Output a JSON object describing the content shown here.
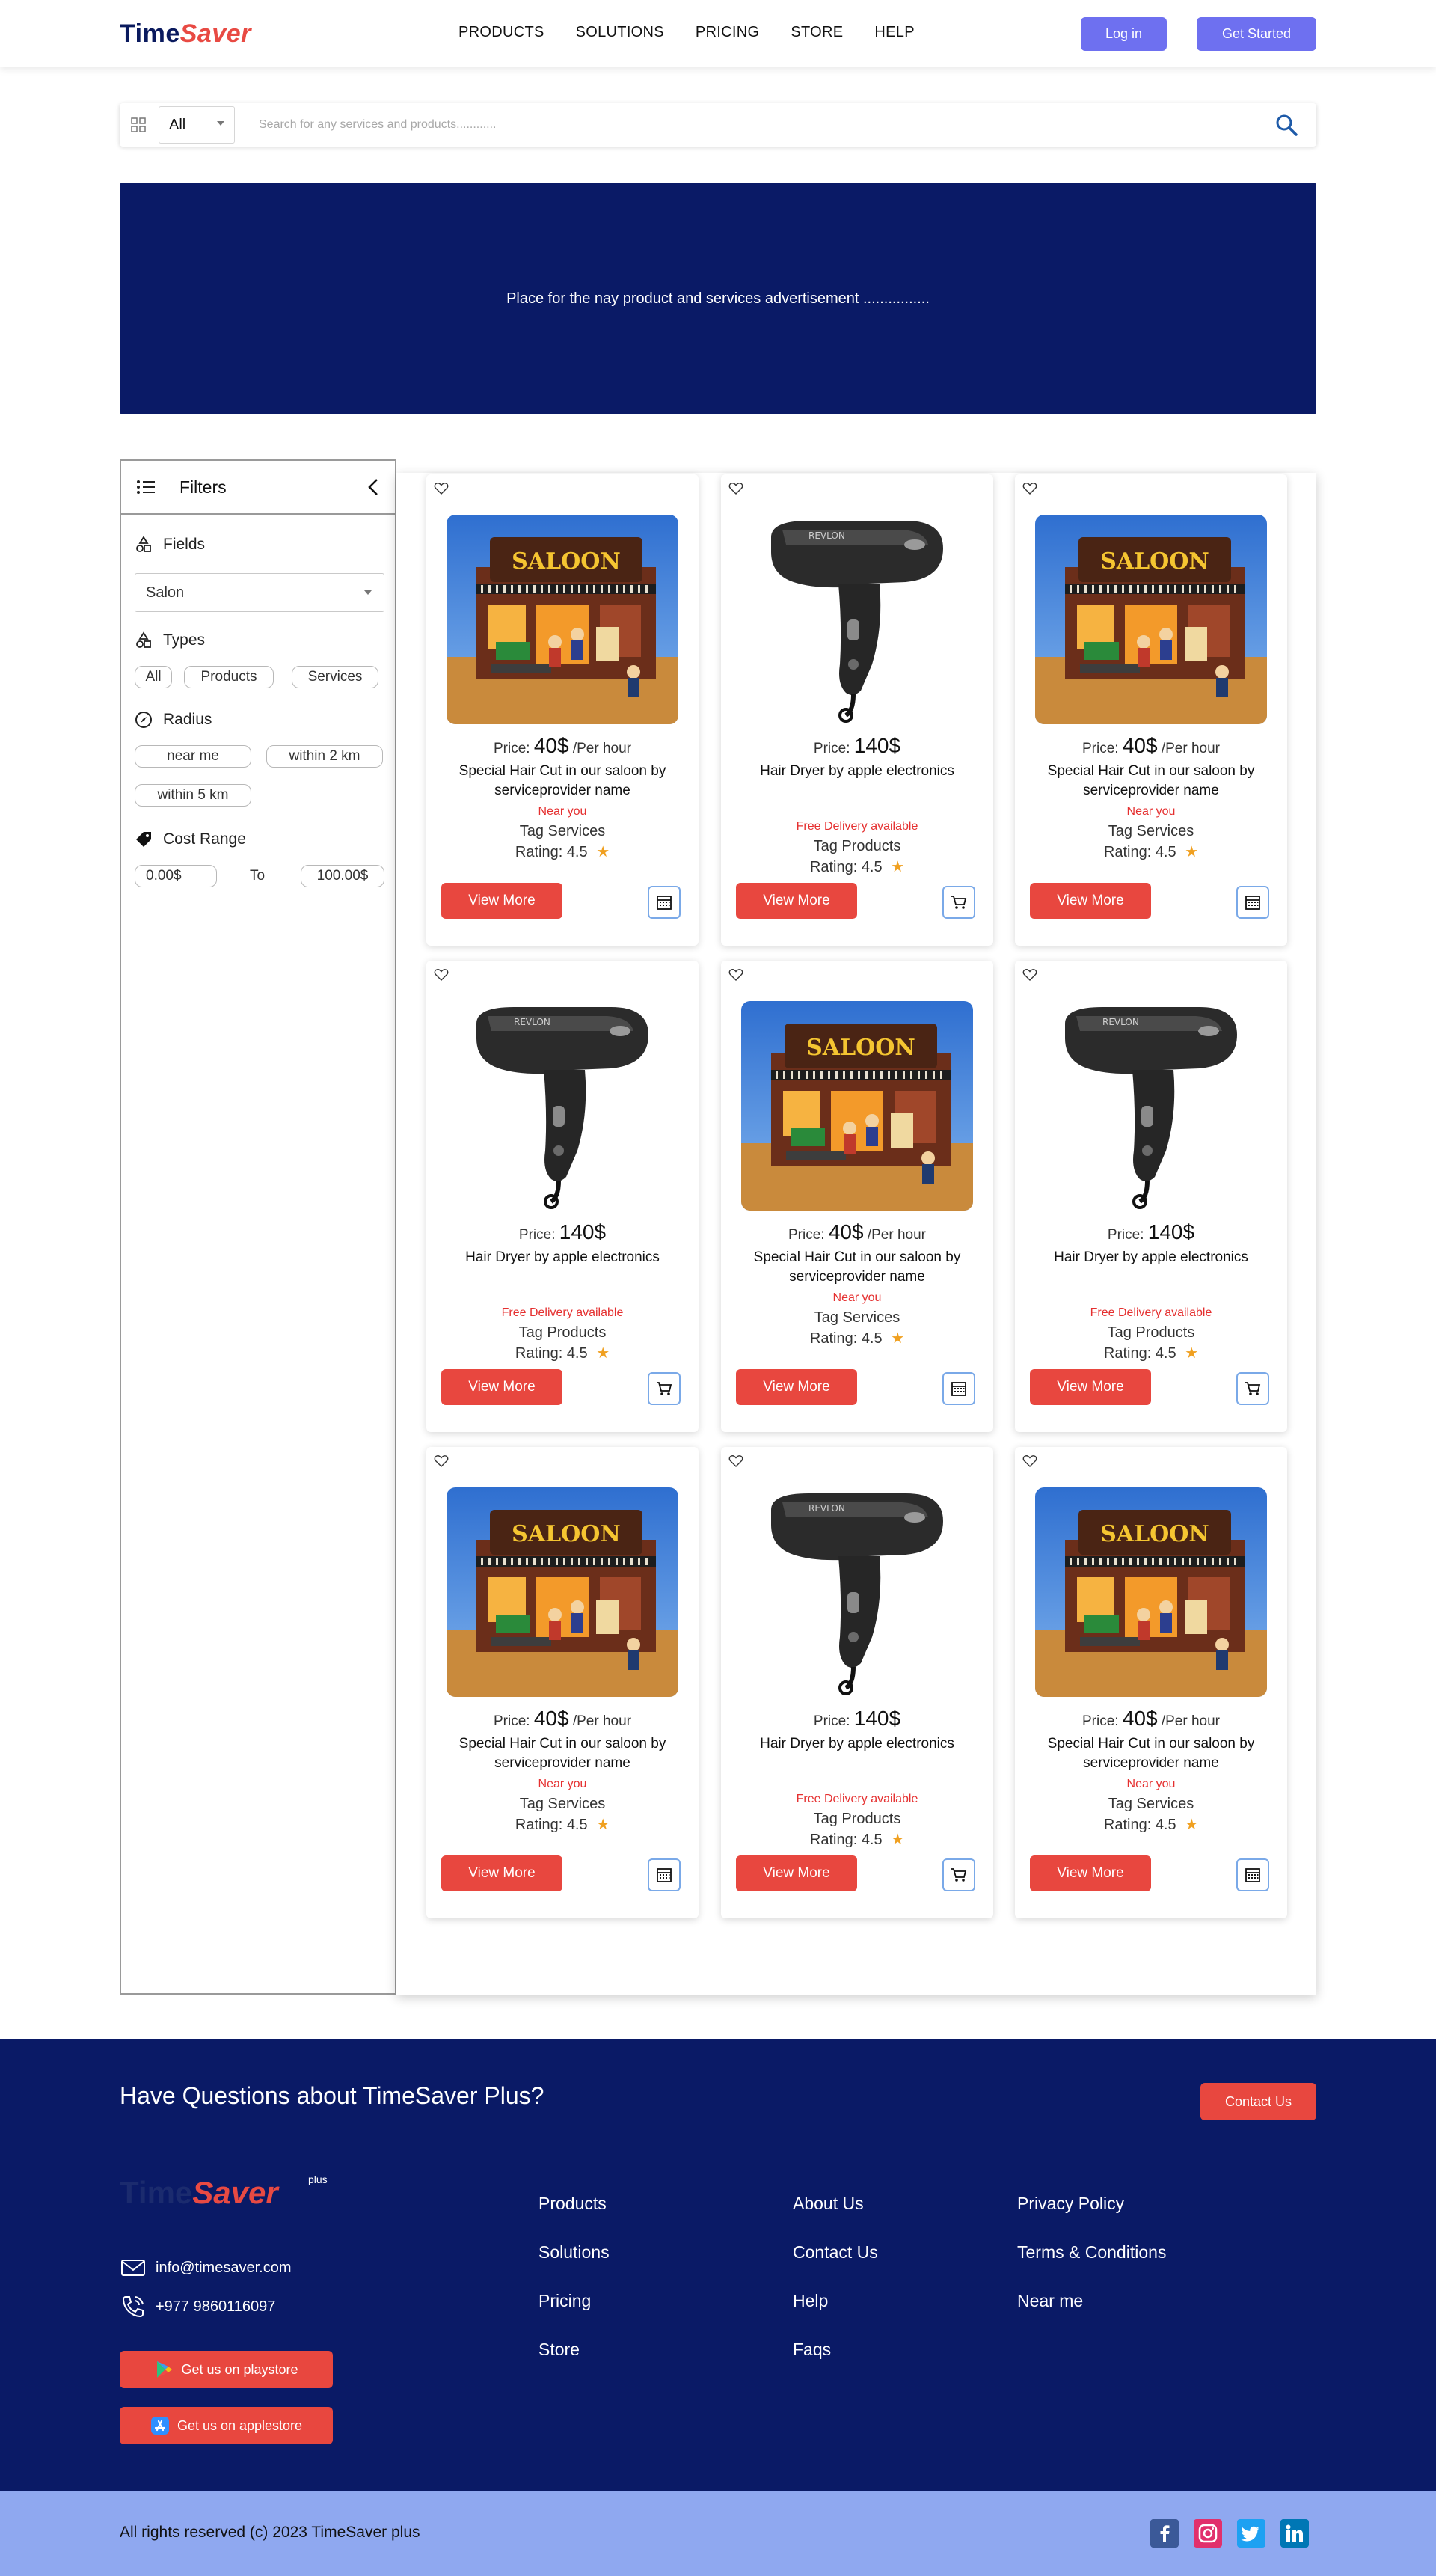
{
  "header": {
    "logo_part1": "Time",
    "logo_part2": "Saver",
    "nav": [
      "PRODUCTS",
      "SOLUTIONS",
      "PRICING",
      "STORE",
      "HELP"
    ],
    "login": "Log in",
    "get_started": "Get Started"
  },
  "search": {
    "category": "All",
    "placeholder": "Search for any services and products............"
  },
  "banner": {
    "text": "Place for the nay product and services advertisement ................"
  },
  "filters": {
    "title": "Filters",
    "fields_label": "Fields",
    "fields_value": "Salon",
    "types_label": "Types",
    "types": [
      "All",
      "Products",
      "Services"
    ],
    "radius_label": "Radius",
    "radius": [
      "near me",
      "within 2 km",
      "within 5 km"
    ],
    "cost_label": "Cost Range",
    "cost_min": "0.00$",
    "cost_to": "To",
    "cost_max": "100.00$"
  },
  "cards": [
    {
      "kind": "salon",
      "price_label": "Price:",
      "price": "40$",
      "unit": "/Per hour",
      "title": "Special Hair Cut in our saloon by serviceprovider name",
      "note": "Near you",
      "tag": "Tag Services",
      "rating_label": "Rating:",
      "rating": "4.5",
      "button": "View More",
      "action_icon": "calendar-icon"
    },
    {
      "kind": "dryer",
      "price_label": "Price:",
      "price": "140$",
      "unit": "",
      "title": "Hair Dryer by apple electronics",
      "note": "Free Delivery available",
      "tag": "Tag Products",
      "rating_label": "Rating:",
      "rating": "4.5",
      "button": "View More",
      "action_icon": "cart-icon"
    },
    {
      "kind": "salon",
      "price_label": "Price:",
      "price": "40$",
      "unit": "/Per hour",
      "title": "Special Hair Cut in our saloon by serviceprovider name",
      "note": "Near you",
      "tag": "Tag Services",
      "rating_label": "Rating:",
      "rating": "4.5",
      "button": "View More",
      "action_icon": "calendar-icon"
    },
    {
      "kind": "dryer",
      "price_label": "Price:",
      "price": "140$",
      "unit": "",
      "title": "Hair Dryer by apple electronics",
      "note": "Free Delivery available",
      "tag": "Tag Products",
      "rating_label": "Rating:",
      "rating": "4.5",
      "button": "View More",
      "action_icon": "cart-icon"
    },
    {
      "kind": "salon",
      "price_label": "Price:",
      "price": "40$",
      "unit": "/Per hour",
      "title": "Special Hair Cut in our saloon by serviceprovider name",
      "note": "Near you",
      "tag": "Tag Services",
      "rating_label": "Rating:",
      "rating": "4.5",
      "button": "View More",
      "action_icon": "calendar-icon"
    },
    {
      "kind": "dryer",
      "price_label": "Price:",
      "price": "140$",
      "unit": "",
      "title": "Hair Dryer by apple electronics",
      "note": "Free Delivery available",
      "tag": "Tag Products",
      "rating_label": "Rating:",
      "rating": "4.5",
      "button": "View More",
      "action_icon": "cart-icon"
    },
    {
      "kind": "salon",
      "price_label": "Price:",
      "price": "40$",
      "unit": "/Per hour",
      "title": "Special Hair Cut in our saloon by serviceprovider name",
      "note": "Near you",
      "tag": "Tag Services",
      "rating_label": "Rating:",
      "rating": "4.5",
      "button": "View More",
      "action_icon": "calendar-icon"
    },
    {
      "kind": "dryer",
      "price_label": "Price:",
      "price": "140$",
      "unit": "",
      "title": "Hair Dryer by apple electronics",
      "note": "Free Delivery available",
      "tag": "Tag Products",
      "rating_label": "Rating:",
      "rating": "4.5",
      "button": "View More",
      "action_icon": "cart-icon"
    },
    {
      "kind": "salon",
      "price_label": "Price:",
      "price": "40$",
      "unit": "/Per hour",
      "title": "Special Hair Cut in our saloon by serviceprovider name",
      "note": "Near you",
      "tag": "Tag Services",
      "rating_label": "Rating:",
      "rating": "4.5",
      "button": "View More",
      "action_icon": "calendar-icon"
    }
  ],
  "footer": {
    "question": "Have Questions about TimeSaver Plus?",
    "contact_button": "Contact Us",
    "logo_part1": "Time",
    "logo_part2": "Saver",
    "logo_plus": "plus",
    "email": "info@timesaver.com",
    "phone": "+977 9860116097",
    "playstore": "Get us on playstore",
    "applestore": "Get us on applestore",
    "col1": [
      "Products",
      "Solutions",
      "Pricing",
      "Store"
    ],
    "col2": [
      "About Us",
      "Contact Us",
      "Help",
      "Faqs"
    ],
    "col3": [
      "Privacy Policy",
      "Terms & Conditions",
      "Near me"
    ],
    "copyright": "All rights reserved (c) 2023 TimeSaver plus",
    "social": [
      "facebook-icon",
      "instagram-icon",
      "twitter-icon",
      "linkedin-icon"
    ]
  },
  "colors": {
    "navy": "#0a1a66",
    "accent_red": "#e8473f",
    "button_purple": "#6e70f0",
    "bottom_bar": "#8fa8f0"
  }
}
